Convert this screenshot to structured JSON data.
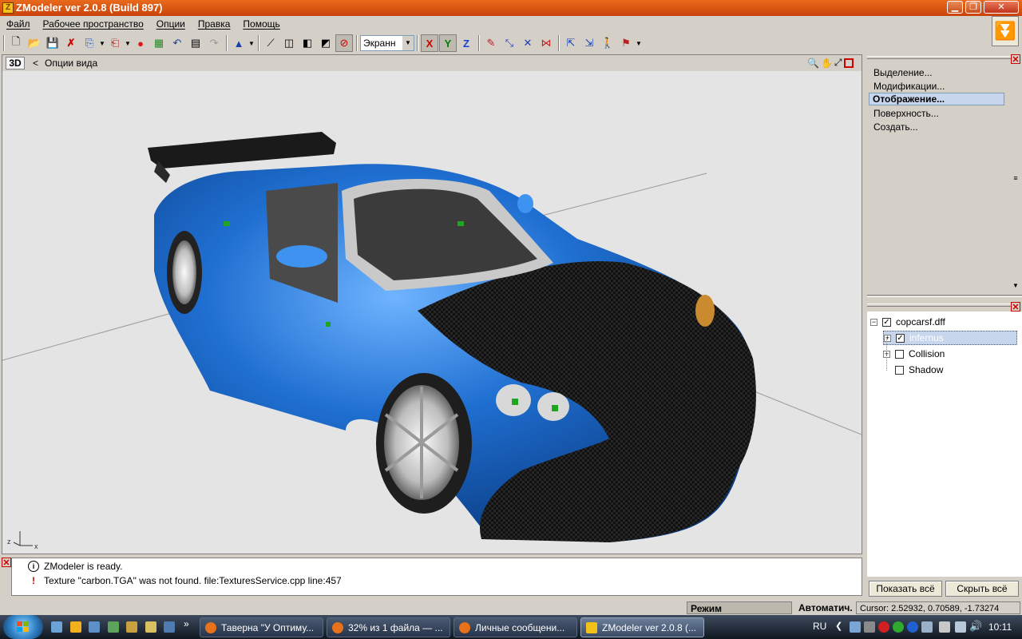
{
  "window": {
    "title": "ZModeler ver 2.0.8 (Build 897)",
    "app_icon": "Z",
    "minimize_icon": "minimize-icon",
    "maximize_icon": "restore-icon",
    "close_icon": "close-icon"
  },
  "menu": [
    "Файл",
    "Рабочее пространство",
    "Опции",
    "Правка",
    "Помощь"
  ],
  "toolbar": {
    "view_mode": "Экранн",
    "axis_x": "X",
    "axis_y": "Y",
    "axis_z": "Z"
  },
  "viewport": {
    "mode_label": "3D",
    "back_label": "<",
    "title": "Опции вида",
    "axis_x": "x",
    "axis_z": "z"
  },
  "right_panel": {
    "items": [
      "Выделение...",
      "Модификации...",
      "Отображение...",
      "Поверхность...",
      "Создать..."
    ],
    "selected_index": 2
  },
  "tree": {
    "root": "copcarsf.dff",
    "nodes": [
      {
        "label": "infernus",
        "checked": true,
        "selected": true,
        "expandable": true
      },
      {
        "label": "Collision",
        "checked": false,
        "selected": false,
        "expandable": true
      },
      {
        "label": "Shadow",
        "checked": false,
        "selected": false,
        "expandable": false
      }
    ],
    "show_all": "Показать всё",
    "hide_all": "Скрыть всё"
  },
  "log": [
    {
      "icon": "info-icon",
      "text": "ZModeler is ready."
    },
    {
      "icon": "warning-icon",
      "text": "Texture \"carbon.TGA\" was not found. file:TexturesService.cpp line:457"
    }
  ],
  "status": {
    "mode": "Режим Выделенного",
    "auto": "Автоматич.",
    "cursor": "Cursor: 2.52932, 0.70589, -1.73274"
  },
  "taskbar": {
    "tasks": [
      {
        "label": "Таверна \"У Оптиму...",
        "icon_color": "#e8711a",
        "active": false
      },
      {
        "label": "32% из 1 файла — ...",
        "icon_color": "#e8711a",
        "active": false
      },
      {
        "label": "Личные сообщени...",
        "icon_color": "#e8711a",
        "active": false
      },
      {
        "label": "ZModeler ver 2.0.8 (...",
        "icon_color": "#f3c21a",
        "active": true
      }
    ],
    "lang": "RU",
    "clock": "10:11",
    "chevron": "»"
  },
  "colors": {
    "title_orange": "#d8561a",
    "selection_blue": "#c7d6ec",
    "car_blue": "#1f6fd1"
  }
}
